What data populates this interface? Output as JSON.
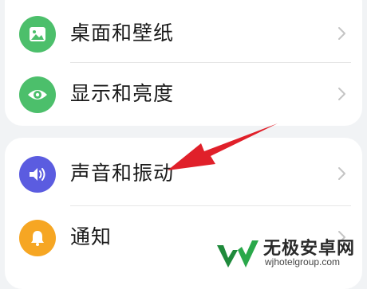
{
  "settings": {
    "group1": [
      {
        "label": "桌面和壁纸",
        "icon": "image-icon",
        "color": "#4cbf6b"
      },
      {
        "label": "显示和亮度",
        "icon": "eye-icon",
        "color": "#4cbf6b"
      }
    ],
    "group2": [
      {
        "label": "声音和振动",
        "icon": "volume-icon",
        "color": "#5b5ce0"
      },
      {
        "label": "通知",
        "icon": "bell-icon",
        "color": "#f6a623"
      }
    ]
  },
  "annotation": {
    "arrow_color": "#e0202a"
  },
  "watermark": {
    "title": "无极安卓网",
    "url": "wjhotelgroup.com"
  }
}
